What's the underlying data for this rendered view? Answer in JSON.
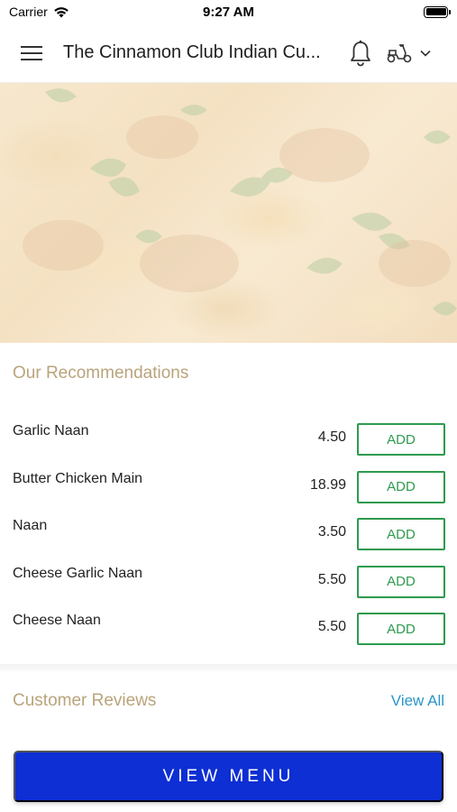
{
  "status_bar": {
    "carrier": "Carrier",
    "time": "9:27 AM"
  },
  "header": {
    "title": "The Cinnamon Club Indian Cu...",
    "icons": [
      "hamburger-menu-icon",
      "bell-icon",
      "scooter-icon",
      "chevron-down-icon"
    ]
  },
  "hero": {
    "image": "food-photo"
  },
  "recommendations": {
    "title": "Our Recommendations",
    "items": [
      {
        "name": "Garlic Naan",
        "price": "4.50",
        "button": "ADD"
      },
      {
        "name": "Butter Chicken Main",
        "price": "18.99",
        "button": "ADD"
      },
      {
        "name": "Naan",
        "price": "3.50",
        "button": "ADD"
      },
      {
        "name": "Cheese Garlic Naan",
        "price": "5.50",
        "button": "ADD"
      },
      {
        "name": "Cheese Naan",
        "price": "5.50",
        "button": "ADD"
      }
    ]
  },
  "reviews": {
    "title": "Customer Reviews",
    "view_all": "View All"
  },
  "footer": {
    "view_menu": "VIEW MENU"
  },
  "colors": {
    "accent_green": "#2e9a4e",
    "section_title": "#b9a47c",
    "link_blue": "#2896c8",
    "primary_button": "#0d2fd3"
  }
}
